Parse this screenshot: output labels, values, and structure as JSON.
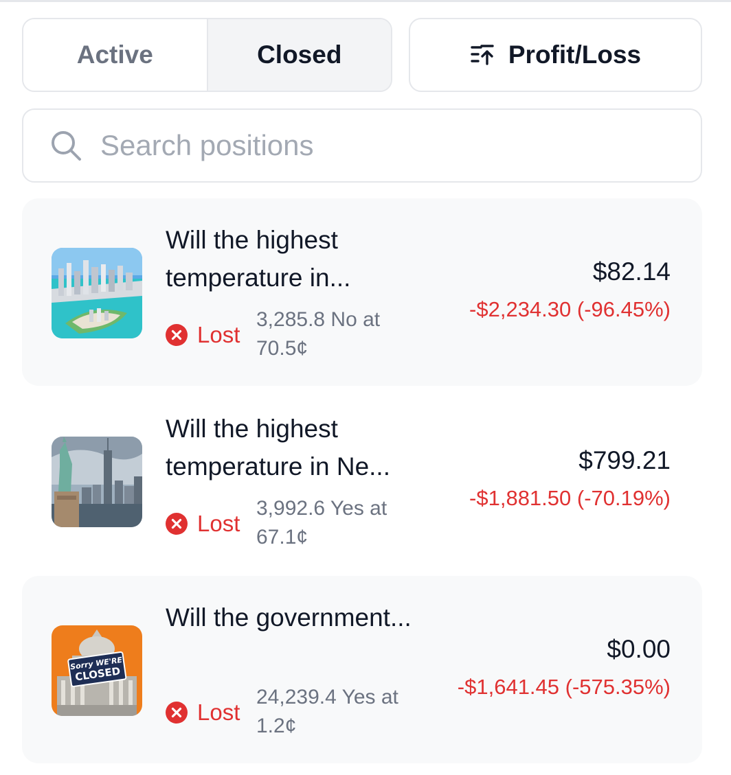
{
  "tabs": [
    {
      "label": "Active",
      "selected": false
    },
    {
      "label": "Closed",
      "selected": true
    }
  ],
  "sort": {
    "label": "Profit/Loss",
    "icon": "sort-icon"
  },
  "search": {
    "placeholder": "Search positions",
    "value": "",
    "icon": "search-icon"
  },
  "positions": [
    {
      "title": "Will the highest temperature in...",
      "status": "Lost",
      "shares": "3,285.8 No at 70.5¢",
      "value": "$82.14",
      "pnl": "-$2,234.30 (-96.45%)",
      "image": "miami-skyline-thumbnail"
    },
    {
      "title": "Will the highest temperature in Ne...",
      "status": "Lost",
      "shares": "3,992.6 Yes at 67.1¢",
      "value": "$799.21",
      "pnl": "-$1,881.50 (-70.19%)",
      "image": "new-york-statue-of-liberty-thumbnail"
    },
    {
      "title": "Will the government...",
      "status": "Lost",
      "shares": "24,239.4 Yes at 1.2¢",
      "value": "$0.00",
      "pnl": "-$1,641.45 (-575.35%)",
      "image": "capitol-closed-sign-thumbnail",
      "image_text": "Sorry WE'RE CLOSED"
    }
  ],
  "colors": {
    "loss": "#e03131",
    "muted": "#6b7280",
    "border": "#e5e7eb",
    "card_bg": "#f8f9fa"
  }
}
